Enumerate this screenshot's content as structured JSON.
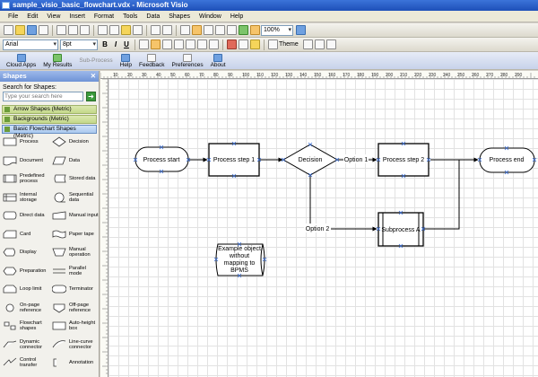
{
  "window": {
    "title": "sample_visio_basic_flowchart.vdx - Microsoft Visio"
  },
  "menu": [
    "File",
    "Edit",
    "View",
    "Insert",
    "Format",
    "Tools",
    "Data",
    "Shapes",
    "Window",
    "Help"
  ],
  "toolbar": {
    "zoom": "100%",
    "font": "Arial",
    "font_size": "8pt",
    "bold": "B",
    "italic": "I",
    "underline": "U",
    "theme_label": "Theme",
    "custom_buttons": [
      {
        "label": "Cloud Apps",
        "icon": "cloud-icon"
      },
      {
        "label": "My Results",
        "icon": "results-icon"
      },
      {
        "label": "Sub-Process",
        "icon": "subprocess-icon"
      },
      {
        "label": "Help",
        "icon": "help-icon"
      },
      {
        "label": "Feedback",
        "icon": "feedback-icon"
      },
      {
        "label": "Preferences",
        "icon": "preferences-icon"
      },
      {
        "label": "About",
        "icon": "about-icon"
      }
    ]
  },
  "sidebar": {
    "title": "Shapes",
    "close_glyph": "✕",
    "search_label": "Search for Shapes:",
    "search_placeholder": "Type your search here",
    "go_glyph": "➜",
    "stencils": [
      "Arrow Shapes (Metric)",
      "Backgrounds (Metric)",
      "Basic Flowchart Shapes (Metric)"
    ],
    "shapes": [
      "Process",
      "Decision",
      "Document",
      "Data",
      "Predefined process",
      "Stored data",
      "Internal storage",
      "Sequential data",
      "Direct data",
      "Manual input",
      "Card",
      "Paper tape",
      "Display",
      "Manual operation",
      "Preparation",
      "Parallel mode",
      "Loop limit",
      "Terminator",
      "On-page reference",
      "Off-page reference",
      "Flowchart shapes",
      "Auto-height box",
      "Dynamic connector",
      "Line-curve connector",
      "Control transfer",
      "Annotation"
    ]
  },
  "ruler": {
    "h_ticks": [
      "10",
      "20",
      "30",
      "40",
      "50",
      "60",
      "70",
      "80",
      "90",
      "100",
      "110",
      "120",
      "130",
      "140",
      "150",
      "160",
      "170",
      "180",
      "190",
      "200",
      "210",
      "220",
      "230",
      "240",
      "250",
      "260",
      "270",
      "280",
      "290"
    ]
  },
  "diagram": {
    "shapes": [
      {
        "id": "start",
        "label": "Process start"
      },
      {
        "id": "step1",
        "label": "Process step 1"
      },
      {
        "id": "decision",
        "label": "Decision"
      },
      {
        "id": "step2",
        "label": "Process step 2"
      },
      {
        "id": "end",
        "label": "Process end"
      },
      {
        "id": "subA",
        "label": "Subprocess A"
      },
      {
        "id": "example",
        "label": [
          "Example object",
          "without",
          "mapping to",
          "BPMS"
        ]
      }
    ],
    "connector_labels": {
      "option1": "Option 1",
      "option2": "Option 2"
    },
    "colors": {
      "line": "#000000",
      "handle": "#3b6fd6"
    }
  }
}
